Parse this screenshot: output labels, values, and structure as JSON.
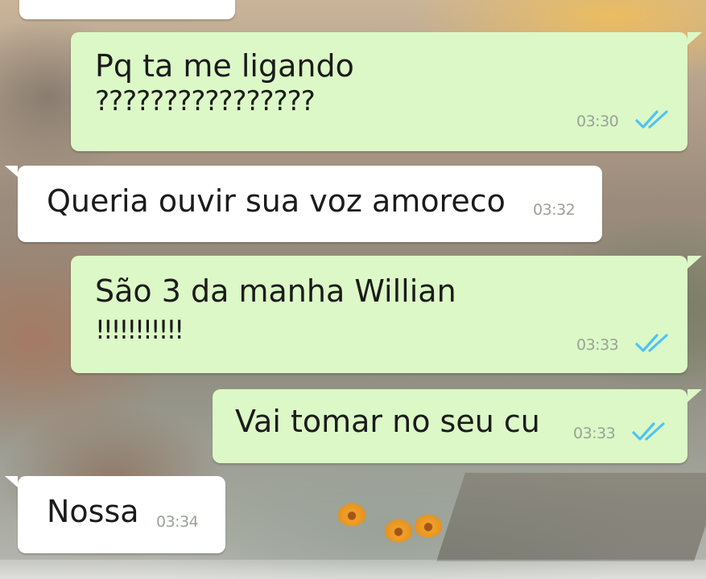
{
  "app": {
    "colors": {
      "incoming_bubble": "#ffffff",
      "outgoing_bubble": "#dcf8c6",
      "read_ticks": "#4fc3f7",
      "timestamp": "#9aa29a"
    }
  },
  "messages": [
    {
      "direction": "outgoing",
      "lines": [
        "Pq ta me ligando",
        "????????????????"
      ],
      "time": "03:30",
      "status": "read-double-check-icon"
    },
    {
      "direction": "incoming",
      "lines": [
        "Queria ouvir sua voz amoreco"
      ],
      "time": "03:32"
    },
    {
      "direction": "outgoing",
      "lines": [
        "São 3 da manha Willian",
        "!!!!!!!!!!!"
      ],
      "time": "03:33",
      "status": "read-double-check-icon"
    },
    {
      "direction": "outgoing",
      "lines": [
        "Vai tomar no seu cu"
      ],
      "time": "03:33",
      "status": "read-double-check-icon"
    },
    {
      "direction": "incoming",
      "lines": [
        "Nossa"
      ],
      "time": "03:34"
    }
  ]
}
